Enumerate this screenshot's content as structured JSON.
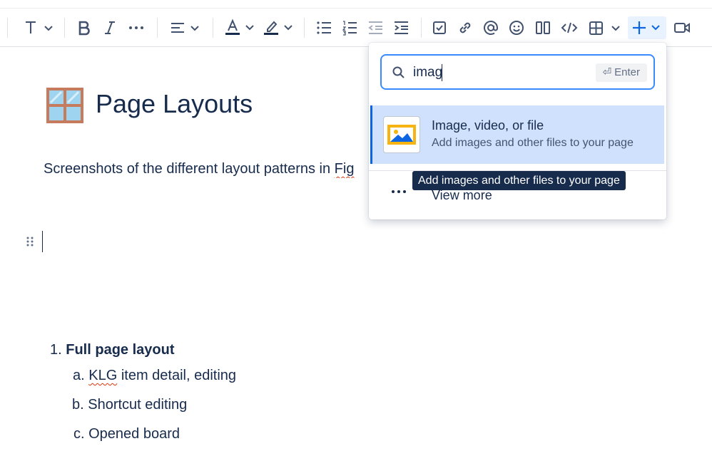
{
  "toolbar": {
    "items": [
      "text-style",
      "bold",
      "italic",
      "more-formatting",
      "alignment",
      "text-color",
      "highlight",
      "bullet-list",
      "numbered-list",
      "outdent",
      "indent",
      "action-item",
      "link",
      "mention",
      "emoji",
      "layouts",
      "code-snippet",
      "table",
      "insert",
      "video"
    ]
  },
  "page": {
    "title": "Page Layouts",
    "description_prefix": "Screenshots of the different layout patterns in ",
    "description_suffix": "Fig",
    "list": {
      "item1_num": "1.",
      "item1": "Full page layout",
      "sub_a_marker": "a.",
      "sub_a_word": "KLG",
      "sub_a_rest": " item detail, editing",
      "sub_b_marker": "b.",
      "sub_b": "Shortcut editing",
      "sub_c_marker": "c.",
      "sub_c": "Opened board"
    }
  },
  "insert_menu": {
    "search_value": "imag",
    "enter_hint": "Enter",
    "enter_symbol": "⏎",
    "option_title": "Image, video, or file",
    "option_subtitle": "Add images and other files to your page",
    "view_more": "View more"
  },
  "tooltip": {
    "text": "Add images and other files to your page"
  },
  "colors": {
    "accent": "#0c66e4",
    "selected_bg": "#cfe1fd",
    "tooltip_bg": "#172b4d",
    "image_icon_yellow": "#f5b40f",
    "image_icon_blue": "#0c66e4"
  }
}
